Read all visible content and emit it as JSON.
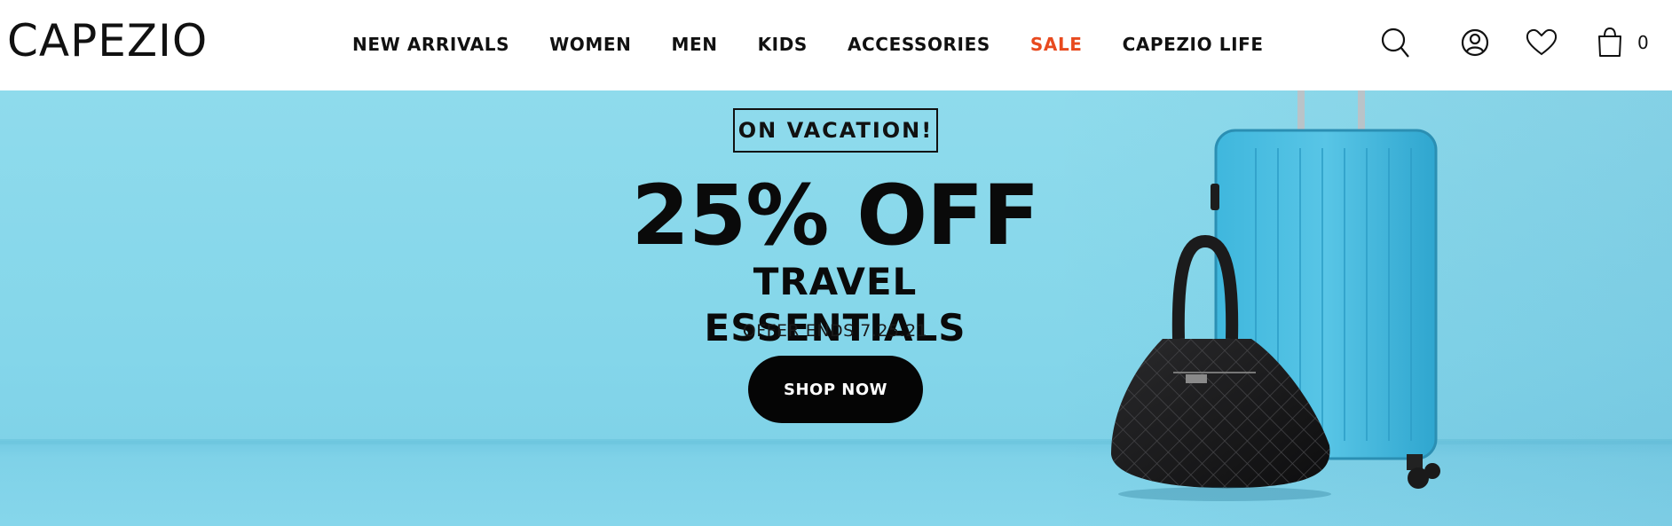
{
  "header": {
    "logo": "CAPEZIO",
    "nav": [
      {
        "label": "NEW ARRIVALS"
      },
      {
        "label": "WOMEN"
      },
      {
        "label": "MEN"
      },
      {
        "label": "KIDS"
      },
      {
        "label": "ACCESSORIES"
      },
      {
        "label": "SALE"
      },
      {
        "label": "CAPEZIO LIFE"
      }
    ],
    "icons": [
      "search-icon",
      "account-icon",
      "heart-icon",
      "cart-icon"
    ],
    "cart_count": "0"
  },
  "hero": {
    "badge": "ON VACATION!",
    "headline": "25% OFF",
    "subhead": "TRAVEL ESSENTIALS",
    "offer": "OFFER ENDS 7.25.21",
    "cta": "SHOP NOW",
    "image": "blue-suitcase-and-black-quilted-tote-bag"
  },
  "colors": {
    "sale": "#e84a1f",
    "hero_bg": "#86d6eb",
    "button_bg": "#050505",
    "text": "#111111"
  }
}
